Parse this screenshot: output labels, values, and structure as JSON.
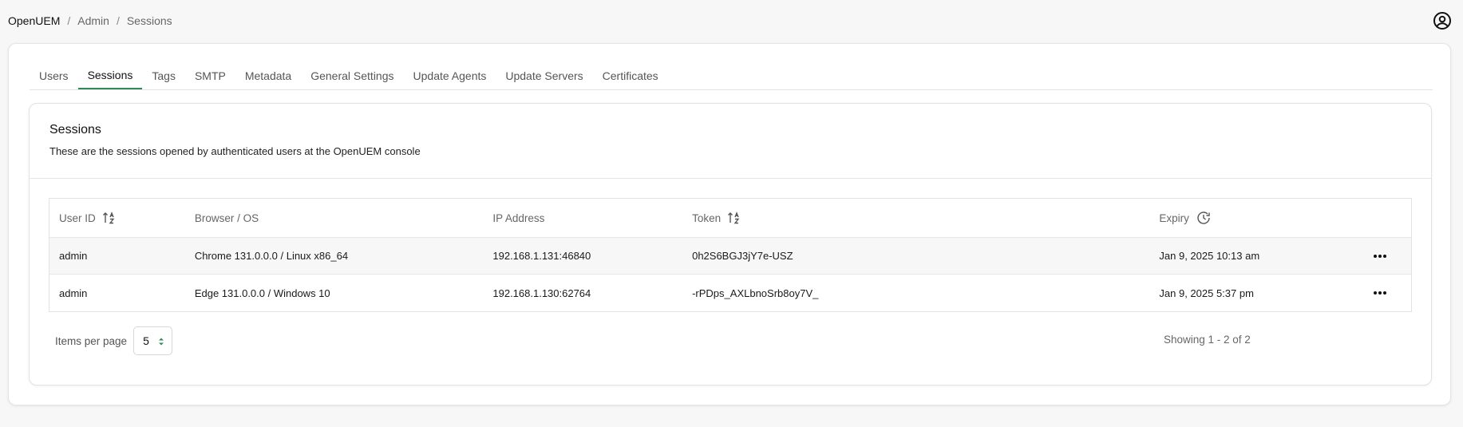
{
  "breadcrumb": [
    "OpenUEM",
    "Admin",
    "Sessions"
  ],
  "tabs": [
    {
      "label": "Users",
      "active": false
    },
    {
      "label": "Sessions",
      "active": true
    },
    {
      "label": "Tags",
      "active": false
    },
    {
      "label": "SMTP",
      "active": false
    },
    {
      "label": "Metadata",
      "active": false
    },
    {
      "label": "General Settings",
      "active": false
    },
    {
      "label": "Update Agents",
      "active": false
    },
    {
      "label": "Update Servers",
      "active": false
    },
    {
      "label": "Certificates",
      "active": false
    }
  ],
  "card": {
    "title": "Sessions",
    "description": "These are the sessions opened by authenticated users at the OpenUEM console"
  },
  "table": {
    "headers": {
      "user_id": "User ID",
      "browser_os": "Browser / OS",
      "ip": "IP Address",
      "token": "Token",
      "expiry": "Expiry"
    },
    "rows": [
      {
        "user_id": "admin",
        "browser_os": "Chrome 131.0.0.0 / Linux x86_64",
        "ip": "192.168.1.131:46840",
        "token": "0h2S6BGJ3jY7e-USZ",
        "expiry": "Jan 9, 2025 10:13 am"
      },
      {
        "user_id": "admin",
        "browser_os": "Edge 131.0.0.0 / Windows 10",
        "ip": "192.168.1.130:62764",
        "token": "-rPDps_AXLbnoSrb8oy7V_",
        "expiry": "Jan 9, 2025 5:37 pm"
      }
    ]
  },
  "pagination": {
    "items_per_page_label": "Items per page",
    "items_per_page_value": "5",
    "showing": "Showing 1 - 2 of 2"
  },
  "colors": {
    "accent": "#2e8b57"
  },
  "icons": [
    "user-circle-icon",
    "sort-alpha-icon",
    "clock-history-icon",
    "more-horizontal-icon",
    "select-arrows-icon"
  ]
}
